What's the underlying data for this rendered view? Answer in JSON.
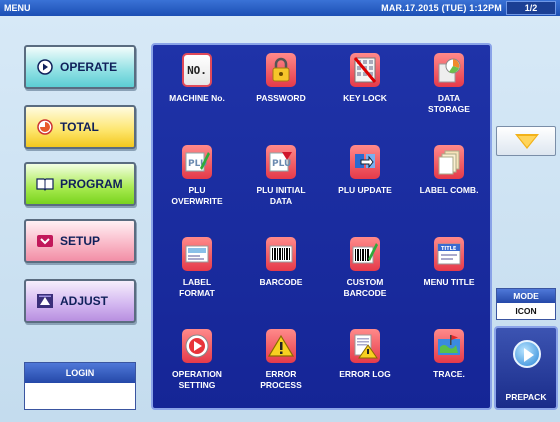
{
  "topbar": {
    "title": "MENU",
    "datetime": "MAR.17.2015 (TUE)  1:12PM",
    "page": "1/2"
  },
  "menu": {
    "operate": "OPERATE",
    "total": "TOTAL",
    "program": "PROGRAM",
    "setup": "SETUP",
    "adjust": "ADJUST"
  },
  "login": {
    "label": "LOGIN"
  },
  "icons": [
    {
      "line1": "MACHINE No.",
      "line2": "",
      "icon": "machine-number-icon"
    },
    {
      "line1": "PASSWORD",
      "line2": "",
      "icon": "padlock-icon"
    },
    {
      "line1": "KEY LOCK",
      "line2": "",
      "icon": "key-lock-icon"
    },
    {
      "line1": "DATA",
      "line2": "STORAGE",
      "icon": "data-storage-icon"
    },
    {
      "line1": "PLU",
      "line2": "OVERWRITE",
      "icon": "plu-overwrite-icon"
    },
    {
      "line1": "PLU INITIAL",
      "line2": "DATA",
      "icon": "plu-initial-data-icon"
    },
    {
      "line1": "PLU UPDATE",
      "line2": "",
      "icon": "plu-update-icon"
    },
    {
      "line1": "LABEL COMB.",
      "line2": "",
      "icon": "label-comb-icon"
    },
    {
      "line1": "LABEL",
      "line2": "FORMAT",
      "icon": "label-format-icon"
    },
    {
      "line1": "BARCODE",
      "line2": "",
      "icon": "barcode-icon"
    },
    {
      "line1": "CUSTOM",
      "line2": "BARCODE",
      "icon": "custom-barcode-icon"
    },
    {
      "line1": "MENU TITLE",
      "line2": "",
      "icon": "menu-title-icon"
    },
    {
      "line1": "OPERATION",
      "line2": "SETTING",
      "icon": "operation-setting-icon"
    },
    {
      "line1": "ERROR",
      "line2": "PROCESS",
      "icon": "error-process-icon"
    },
    {
      "line1": "ERROR LOG",
      "line2": "",
      "icon": "error-log-icon"
    },
    {
      "line1": "TRACE.",
      "line2": "",
      "icon": "trace-icon"
    }
  ],
  "mode": {
    "label": "MODE",
    "value": "ICON"
  },
  "prepack": {
    "label": "PREPACK"
  }
}
